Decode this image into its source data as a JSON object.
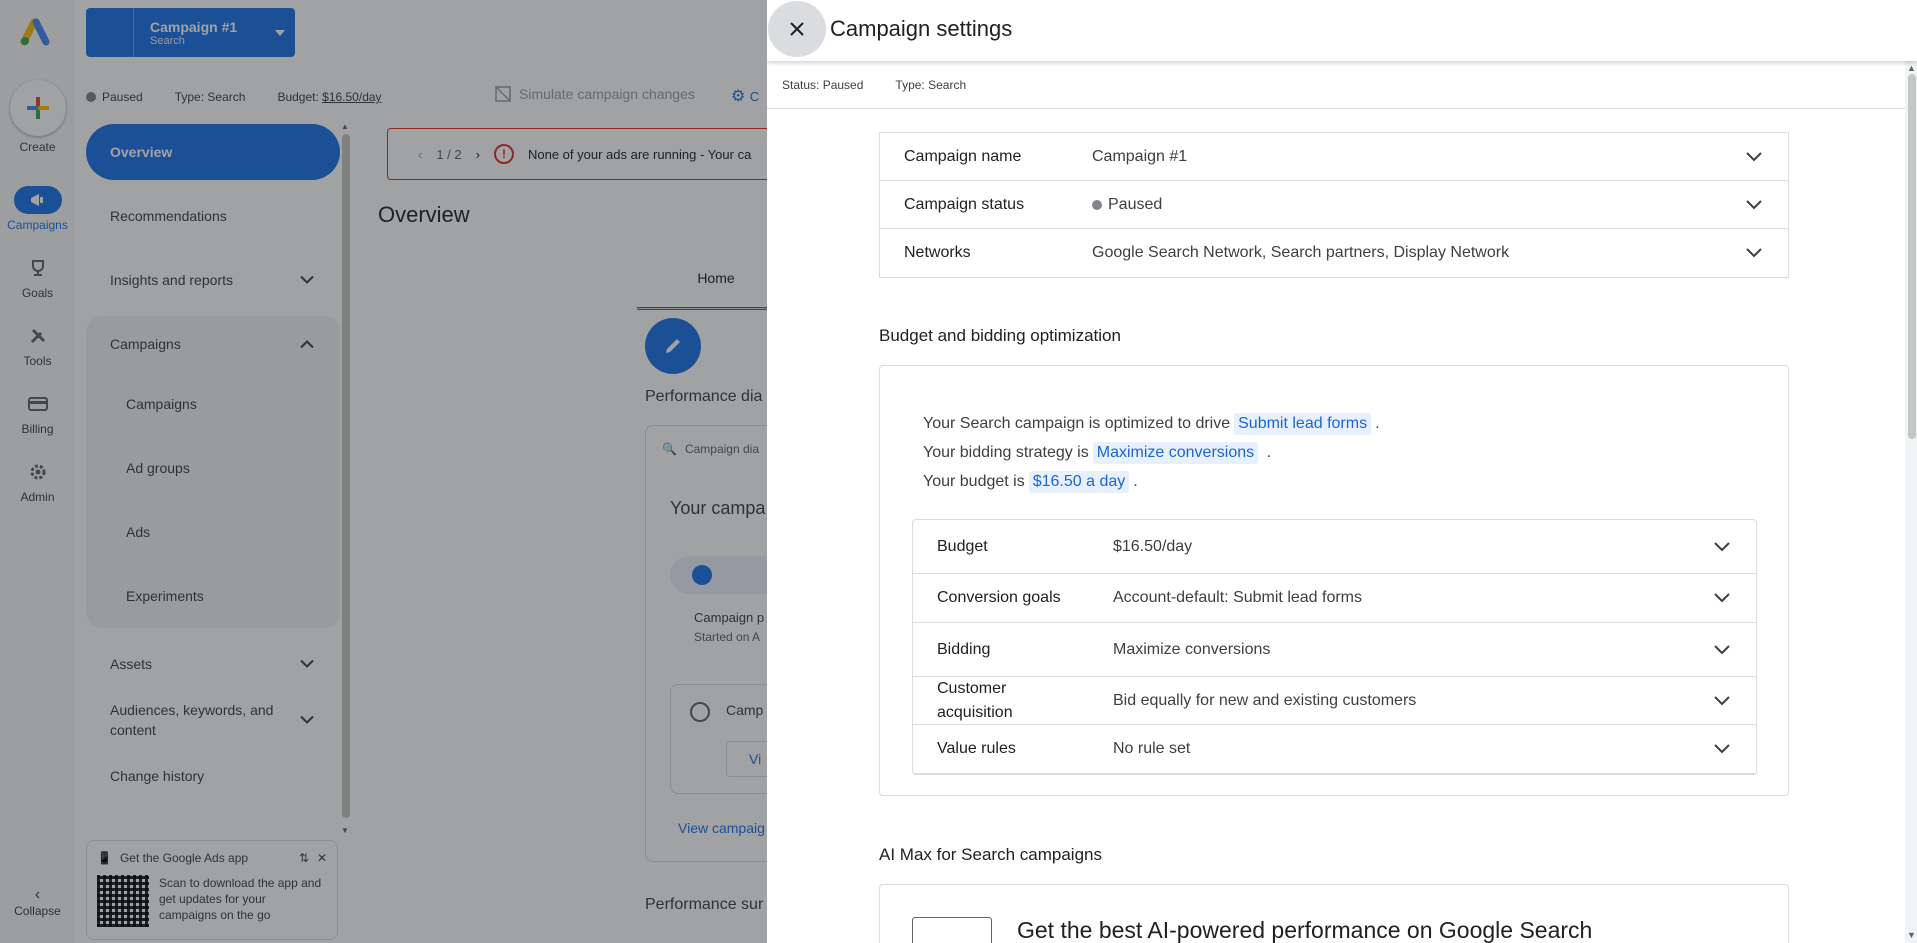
{
  "rail": {
    "create_label": "Create",
    "items": [
      {
        "label": "Campaigns",
        "icon": "megaphone-icon"
      },
      {
        "label": "Goals",
        "icon": "trophy-icon"
      },
      {
        "label": "Tools",
        "icon": "tools-icon"
      },
      {
        "label": "Billing",
        "icon": "credit-card-icon"
      },
      {
        "label": "Admin",
        "icon": "gear-icon"
      }
    ],
    "collapse_label": "Collapse"
  },
  "campaign_picker": {
    "title": "Campaign #1",
    "subtitle": "Search"
  },
  "statusbar": {
    "status": "Paused",
    "type_label": "Type:",
    "type_value": "Search",
    "budget_label": "Budget:",
    "budget_value": "$16.50/day",
    "simulate": "Simulate campaign changes",
    "cut_label": "C"
  },
  "nav": {
    "overview": "Overview",
    "recommendations": "Recommendations",
    "insights": "Insights and reports",
    "campaigns_group": "Campaigns",
    "campaigns": "Campaigns",
    "ad_groups": "Ad groups",
    "ads": "Ads",
    "experiments": "Experiments",
    "assets": "Assets",
    "audiences": "Audiences, keywords, and content",
    "change_history": "Change history"
  },
  "promo": {
    "title": "Get the Google Ads app",
    "body": "Scan to download the app and get updates for your campaigns on the go"
  },
  "main": {
    "alert_pager": "1 / 2",
    "alert_text": "None of your ads are running - Your ca",
    "title": "Overview",
    "tab_home": "Home",
    "perf_diag": "Performance dia",
    "diag_head": "Campaign dia",
    "diag_title": "Your campa",
    "diag_sub1": "Campaign p",
    "diag_sub2": "Started on A",
    "diag_inner": "Camp",
    "diag_btn": "Vi",
    "diag_link": "View campaig",
    "perf_sum": "Performance sur"
  },
  "panel": {
    "title": "Campaign settings",
    "status_label": "Status:",
    "status_value": "Paused",
    "type_label": "Type:",
    "type_value": "Search",
    "top_rows": [
      {
        "label": "Campaign name",
        "value": "Campaign #1"
      },
      {
        "label": "Campaign status",
        "value": "Paused"
      },
      {
        "label": "Networks",
        "value": "Google Search Network, Search partners, Display Network"
      }
    ],
    "budget_section": "Budget and bidding optimization",
    "opt_line1_pre": "Your Search campaign is optimized to drive",
    "opt_line1_chip": "Submit lead forms",
    "opt_line2_pre": "Your bidding strategy is",
    "opt_line2_chip": "Maximize conversions",
    "opt_line3_pre": "Your budget is",
    "opt_line3_chip": "$16.50 a day",
    "period": ".",
    "inner_rows": [
      {
        "label": "Budget",
        "value": "$16.50/day"
      },
      {
        "label": "Conversion goals",
        "value": "Account-default: Submit lead forms"
      },
      {
        "label": "Bidding",
        "value": "Maximize conversions"
      },
      {
        "label": "Customer acquisition",
        "value": "Bid equally for new and existing customers"
      },
      {
        "label": "Value rules",
        "value": "No rule set"
      }
    ],
    "aimax_section": "AI Max for Search campaigns",
    "aimax_headline": "Get the best AI-powered performance on Google Search"
  },
  "colors": {
    "brand_blue": "#1a73e8",
    "error_red": "#d93025",
    "chip_bg": "#e8f0fe"
  }
}
